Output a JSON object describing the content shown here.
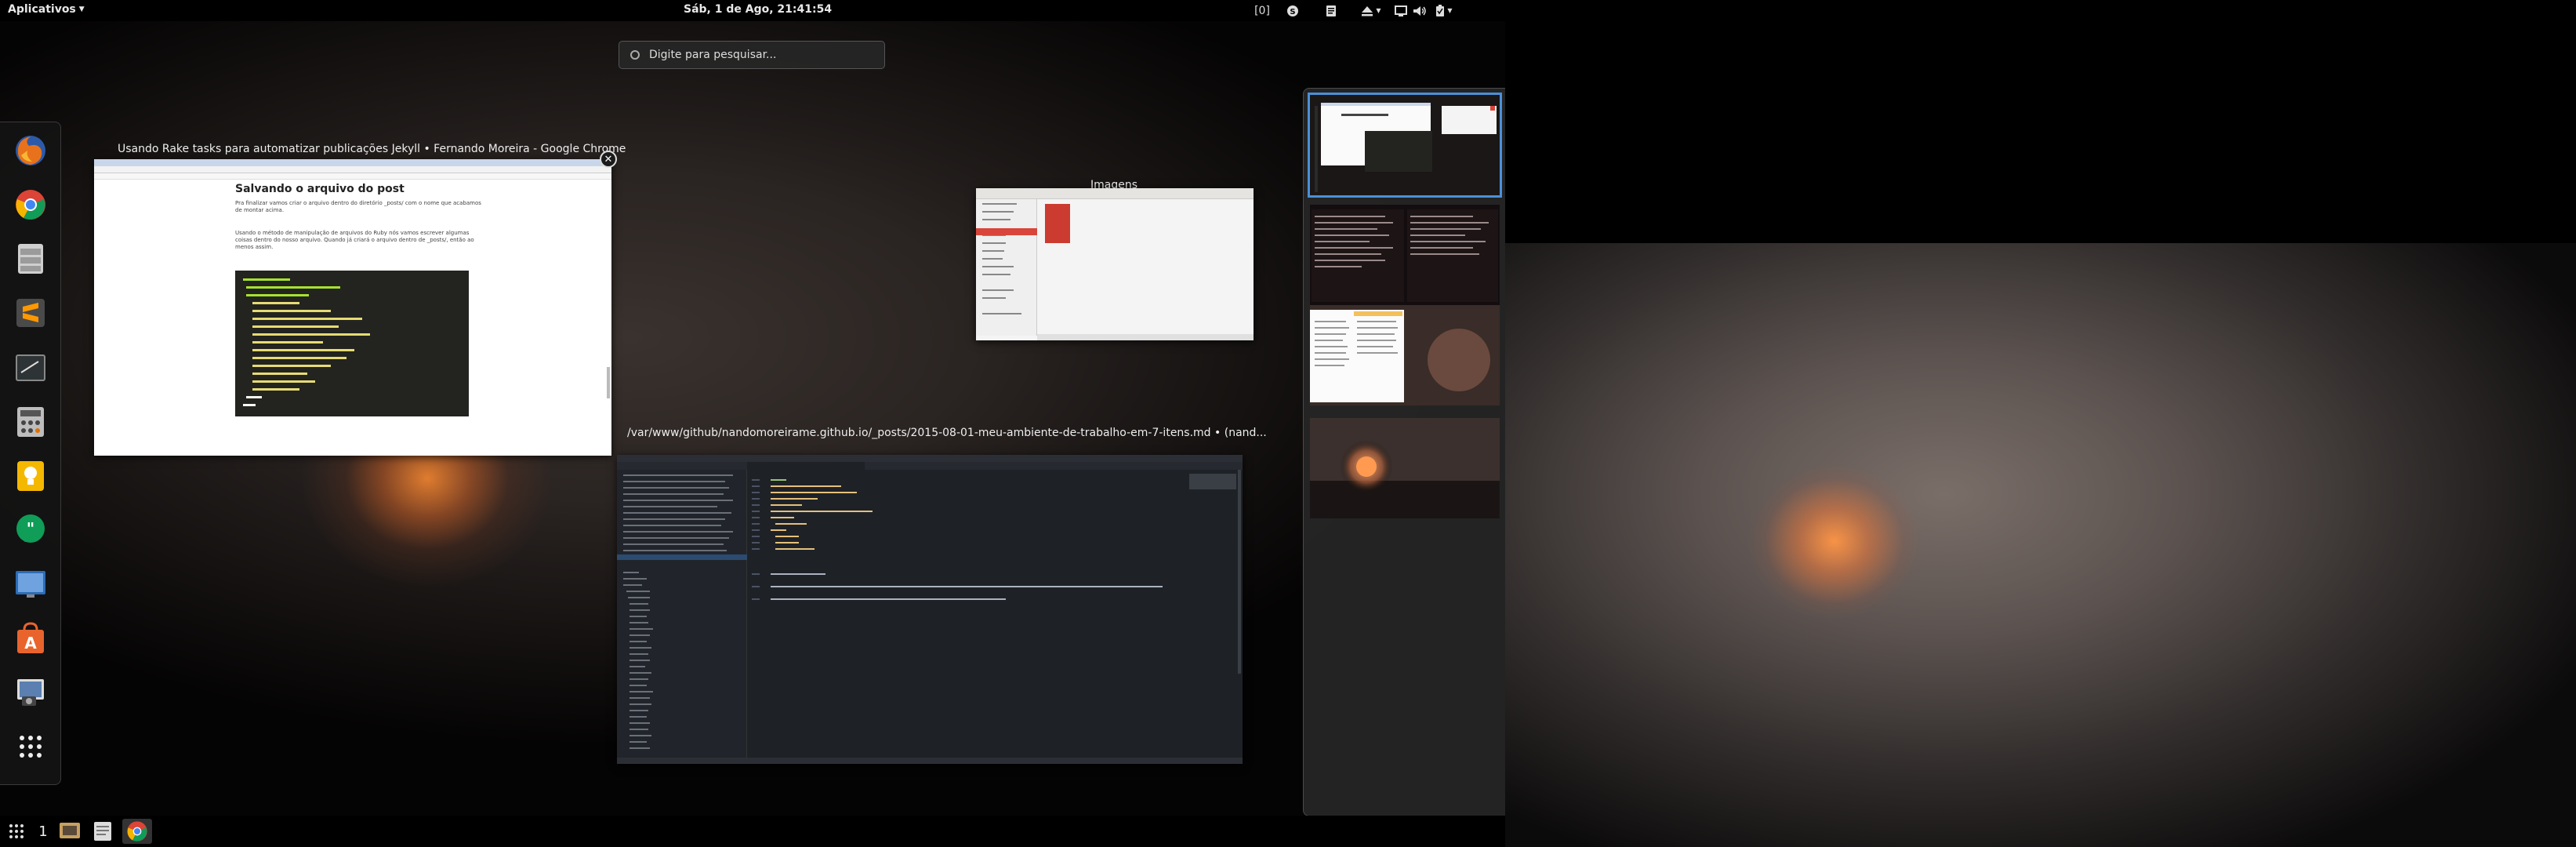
{
  "top_bar": {
    "apps_menu_label": "Aplicativos",
    "clock": "Sáb,  1 de Ago, 21:41:54",
    "workspace_indicator": "[0]"
  },
  "search": {
    "placeholder": "Digite para pesquisar..."
  },
  "windows": {
    "chrome_title": "Usando Rake tasks para automatizar publicações Jekyll • Fernando Moreira - Google Chrome",
    "chrome_page_heading": "Salvando o arquivo do post",
    "chrome_page_para1": "Pra finalizar vamos criar o arquivo dentro do diretório _posts/ com o nome que acabamos de montar acima.",
    "chrome_page_para2": "Usando o método de manipulação de arquivos do Ruby nós vamos escrever algumas coisas dentro do nosso arquivo. Quando já criará o arquivo dentro de _posts/, então ao menos assim.",
    "images_title": "Imagens",
    "editor_title": "/var/www/github/nandomoreirame.github.io/_posts/2015-08-01-meu-ambiente-de-trabalho-em-7-itens.md • (nand..."
  },
  "dash_apps": [
    "firefox-icon",
    "chrome-icon",
    "files-icon",
    "sublime-text-icon",
    "terminal-icon",
    "calculator-icon",
    "bulb-icon",
    "hangouts-icon",
    "desktop-icon",
    "software-center-icon",
    "screenshot-icon",
    "show-apps-icon"
  ],
  "bottom_tray": {
    "count": "1"
  },
  "colors": {
    "accent": "#4a90d9",
    "nautilus_red": "#d9453a",
    "panel": "#000000"
  }
}
